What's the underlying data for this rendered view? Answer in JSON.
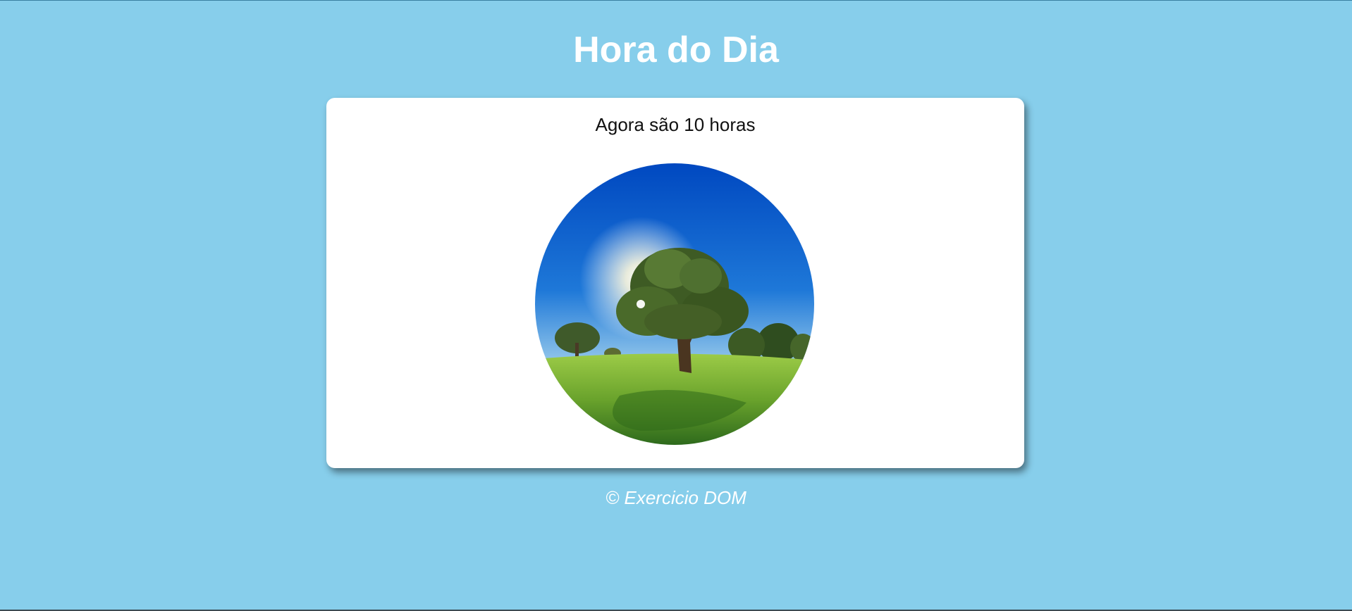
{
  "header": {
    "title": "Hora do Dia"
  },
  "card": {
    "message": "Agora são 10 horas",
    "image": {
      "subject": "morning-tree-landscape",
      "shape": "circle"
    }
  },
  "footer": {
    "text": "© Exercicio DOM"
  },
  "colors": {
    "background": "#87ceeb",
    "card": "#ffffff",
    "title": "#ffffff",
    "message": "#111111"
  }
}
